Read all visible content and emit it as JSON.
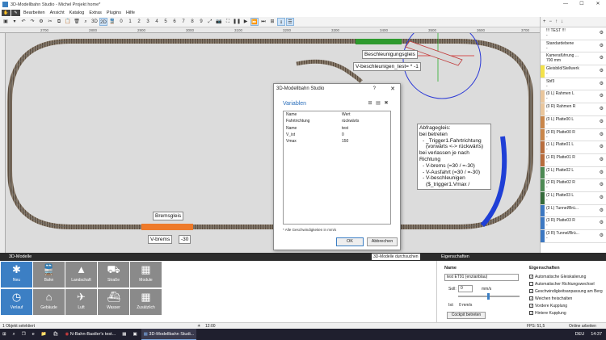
{
  "window": {
    "title": "3D-Modellbahn Studio - Michel Projekt home*",
    "controls": [
      "—",
      "☐",
      "✕"
    ]
  },
  "menu": {
    "items": [
      "Bearbeiten",
      "Ansicht",
      "Katalog",
      "Extras",
      "Plugins",
      "Hilfe"
    ]
  },
  "toolbar": {
    "btn_3d": "3D",
    "btn_2d": "2D",
    "nums": [
      "0",
      "1",
      "2",
      "3",
      "4",
      "5",
      "6",
      "7",
      "8",
      "9"
    ]
  },
  "ruler": {
    "top_ticks": [
      "2700",
      "2800",
      "2900",
      "3000",
      "3100",
      "3200",
      "3300",
      "3400",
      "3500",
      "3600",
      "3700"
    ]
  },
  "canvas": {
    "labels": {
      "beschleunigung": "Beschleunigungsgleis",
      "v_beschleunigen": "V-beschleunigen_test= * -1",
      "bremsgleis": "Bremsgleis",
      "v_brems": "V-brems",
      "v_brems_val": "-30"
    },
    "info_lines": [
      "Abfragegleis:",
      "bei betreten",
      "- _Trigger1.Fahrtrichtung",
      "(vorwärts <-> rückwärts)",
      "bei verlassen je nach Richtung",
      "- V-brems (=30 / =-30)",
      "- V-Ausfahrt (=30 / =-30)",
      "- V-beschleunigen",
      "($_trigger1.Vmax /"
    ]
  },
  "dialog": {
    "title": "3D-Modellbahn Studio",
    "help": "?",
    "close": "✕",
    "heading": "Variablen",
    "col_name": "Name",
    "col_value": "Wert",
    "rows": [
      {
        "k": "Fahrtrichtung",
        "v": "rückwärts"
      },
      {
        "k": "Name",
        "v": "test"
      },
      {
        "k": "V_ist",
        "v": "0"
      },
      {
        "k": "Vmax",
        "v": "150"
      }
    ],
    "note": "* Alle Geschwindigkeiten in mm/s",
    "ok": "OK",
    "cancel": "Abbrechen"
  },
  "layers": {
    "items": [
      {
        "name": "!!! TEST !!!",
        "sub": "-",
        "color": "#ffffff"
      },
      {
        "name": "Standardebene",
        "sub": "-",
        "color": "#ffffff"
      },
      {
        "name": "Kameraführung ...",
        "sub": "700 mm",
        "color": "#ffffff"
      },
      {
        "name": "Gleisbild/Stellwerk",
        "sub": "-",
        "color": "#f3e24a"
      },
      {
        "name": "Sbf3",
        "sub": "-",
        "color": "#ffffff"
      },
      {
        "name": "(0 L) Rahmen L",
        "sub": "-",
        "color": "#e9c69c"
      },
      {
        "name": "(0 R) Rahmen R",
        "sub": "-",
        "color": "#e9c69c"
      },
      {
        "name": "(0 L) Platte00 L",
        "sub": "-",
        "color": "#c9864a"
      },
      {
        "name": "(0 R) Platte00 R",
        "sub": "-",
        "color": "#c9864a"
      },
      {
        "name": "(1 L) Platte01 L",
        "sub": "-",
        "color": "#b86d3d"
      },
      {
        "name": "(1 R) Platte01 R",
        "sub": "-",
        "color": "#b86d3d"
      },
      {
        "name": "(2 L) Platte02 L",
        "sub": "-",
        "color": "#4d8a54"
      },
      {
        "name": "(2 R) Platte02 R",
        "sub": "-",
        "color": "#4d8a54"
      },
      {
        "name": "(2 L) Platte03 L",
        "sub": "-",
        "color": "#356b3b"
      },
      {
        "name": "(3 L) Tunnel/Brü...",
        "sub": "-",
        "color": "#3d78c2"
      },
      {
        "name": "(3 R) Platte03 R",
        "sub": "-",
        "color": "#3d78c2"
      },
      {
        "name": "(3 R) Tunnel/Brü...",
        "sub": "-",
        "color": "#3d78c2"
      }
    ]
  },
  "bottom_left": {
    "title": "3D-Modelle",
    "tab_browse": "3D-Modelle durchsuchen",
    "tab_props": "Eigenschaften",
    "tiles": [
      {
        "label": "Neu",
        "icon": "✱"
      },
      {
        "label": "Bahn",
        "icon": "🚆"
      },
      {
        "label": "Landschaft",
        "icon": "▲"
      },
      {
        "label": "Straße",
        "icon": "⛟"
      },
      {
        "label": "Module",
        "icon": "▦"
      },
      {
        "label": "Verlauf",
        "icon": "◷"
      },
      {
        "label": "Gebäude",
        "icon": "⌂"
      },
      {
        "label": "Luft",
        "icon": "✈"
      },
      {
        "label": "Wasser",
        "icon": "⛴"
      },
      {
        "label": "Zusätzlich",
        "icon": "▦"
      }
    ]
  },
  "props": {
    "name_label": "Name",
    "name_value": "test ET91 (enzianblau)",
    "soll_label": "Soll:",
    "soll_value": "0",
    "soll_unit": "mm/s",
    "ist_label": "Ist:",
    "ist_value": "0 mm/s",
    "cockpit": "Cockpit betreten",
    "eig_header": "Eigenschaften",
    "checks": [
      "Automatische Gleiskalierung",
      "Automatischer Richtungswechsel",
      "Geschwindigkeitsanpassung am Berg",
      "Weichen freischalten",
      "Vordere Kupplung",
      "Hintere Kupplung"
    ]
  },
  "status": {
    "left": "1 Objekt selektiert",
    "clock": "12:00",
    "fps": "FPS: 51,5",
    "mode": "Online arbeiten"
  },
  "taskbar": {
    "items": [
      "N-Bahn-Bastler's test...",
      "3D-Modellbahn Studi..."
    ],
    "lang": "DEU",
    "time": "14:37"
  }
}
